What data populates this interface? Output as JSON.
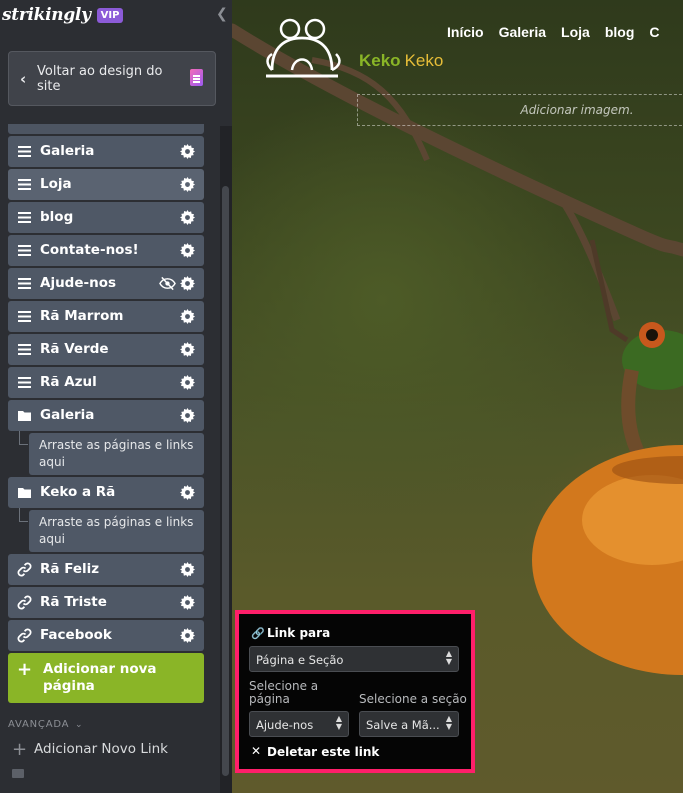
{
  "sidebar": {
    "brand": "strikingly",
    "badge": "VIP",
    "back_button": "Voltar ao design do site",
    "nav_items": [
      {
        "label": "Galeria",
        "icon": "menu-icon"
      },
      {
        "label": "Loja",
        "icon": "menu-icon"
      },
      {
        "label": "blog",
        "icon": "menu-icon"
      },
      {
        "label": "Contate-nos!",
        "icon": "menu-icon"
      },
      {
        "label": "Ajude-nos",
        "icon": "menu-icon",
        "hidden": true
      },
      {
        "label": "Rã Marrom",
        "icon": "menu-icon"
      },
      {
        "label": "Rã Verde",
        "icon": "menu-icon"
      },
      {
        "label": "Rã Azul",
        "icon": "menu-icon"
      },
      {
        "label": "Galeria",
        "icon": "folder-icon"
      },
      {
        "label": "Keko a Rã",
        "icon": "folder-icon"
      },
      {
        "label": "Rã Feliz",
        "icon": "link-icon"
      },
      {
        "label": "Rã Triste",
        "icon": "link-icon"
      },
      {
        "label": "Facebook",
        "icon": "link-icon"
      }
    ],
    "drop_zone_text": "Arraste as páginas e links aqui",
    "add_page": "Adicionar nova página",
    "advanced": "AVANÇADA",
    "add_link": "Adicionar Novo Link"
  },
  "site": {
    "name_part1": "Keko",
    "name_part2": "Keko",
    "nav": [
      "Início",
      "Galeria",
      "Loja",
      "blog",
      "C"
    ],
    "add_image": "Adicionar imagem."
  },
  "link_popup": {
    "title": "Link para",
    "link_type": "Página e Seção",
    "page_label": "Selecione a página",
    "section_label": "Selecione a seção",
    "page_value": "Ajude-nos",
    "section_value": "Salve a Mã...",
    "delete": "Deletar este link"
  },
  "colors": {
    "accent_green": "#8ab527",
    "accent_yellow": "#e6bd38",
    "highlight_border": "#ff1f6a",
    "vip_purple": "#8c5bd8"
  }
}
